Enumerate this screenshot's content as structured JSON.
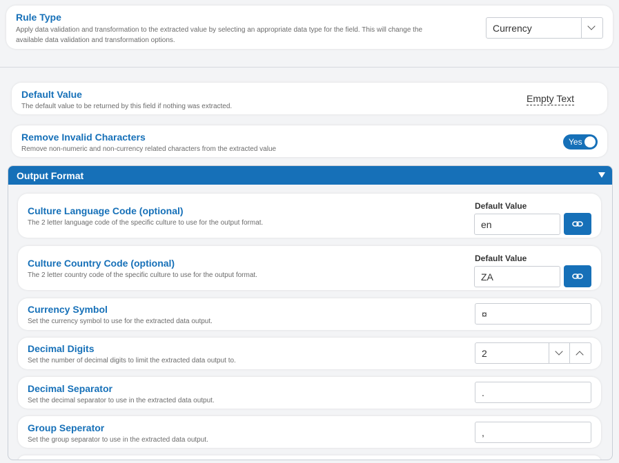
{
  "rule_type": {
    "title": "Rule Type",
    "description": "Apply data validation and transformation to the extracted value by selecting an appropriate data type for the field. This will change the",
    "description2": "available data validation and transformation options.",
    "selected": "Currency"
  },
  "default_value": {
    "title": "Default Value",
    "description": "The default value to be returned by this field if nothing was extracted.",
    "value": "Empty Text"
  },
  "remove_invalid": {
    "title": "Remove Invalid Characters",
    "description": "Remove non-numeric and non-currency related characters from the extracted value",
    "toggle_label": "Yes"
  },
  "output_format": {
    "title": "Output Format",
    "culture_language": {
      "title": "Culture Language Code (optional)",
      "description": "The 2 letter language code of the specific culture to use for the output format.",
      "field_label": "Default Value",
      "value": "en"
    },
    "culture_country": {
      "title": "Culture Country Code (optional)",
      "description": "The 2 letter country code of the specific culture to use for the output format.",
      "field_label": "Default Value",
      "value": "ZA"
    },
    "currency_symbol": {
      "title": "Currency Symbol",
      "description": "Set the currency symbol to use for the extracted data output.",
      "value": "¤"
    },
    "decimal_digits": {
      "title": "Decimal Digits",
      "description": "Set the number of decimal digits to limit the extracted data output to.",
      "value": "2"
    },
    "decimal_separator": {
      "title": "Decimal Separator",
      "description": "Set the decimal separator to use in the extracted data output.",
      "value": "."
    },
    "group_separator": {
      "title": "Group Seperator",
      "description": "Set the group separator to use in the extracted data output.",
      "value": ","
    }
  },
  "colors": {
    "accent": "#1670b8",
    "background": "#f3f4f6"
  },
  "icons": {
    "link": "link-icon",
    "chevron_down": "chevron-down-icon",
    "chevron_up": "chevron-up-icon",
    "collapse": "triangle-down-icon"
  }
}
